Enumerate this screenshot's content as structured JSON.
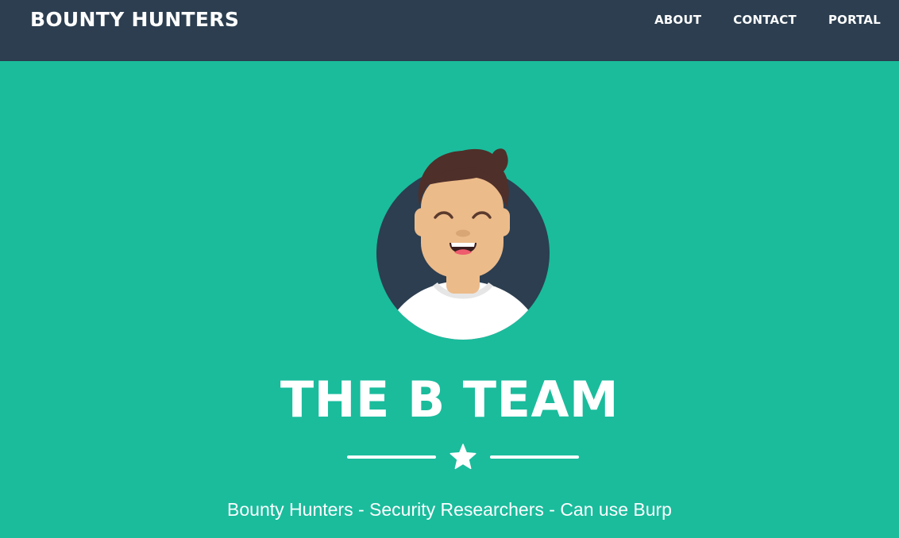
{
  "navbar": {
    "brand": "BOUNTY HUNTERS",
    "links": [
      {
        "label": "ABOUT"
      },
      {
        "label": "CONTACT"
      },
      {
        "label": "PORTAL"
      }
    ]
  },
  "masthead": {
    "avatar_icon": "smiling-avatar-icon",
    "title": "THE B TEAM",
    "divider_icon": "star-icon",
    "subtitle": "Bounty Hunters - Security Researchers - Can use Burp"
  },
  "colors": {
    "navbar_bg": "#2c3e50",
    "page_bg": "#1abc9c",
    "text": "#ffffff"
  }
}
